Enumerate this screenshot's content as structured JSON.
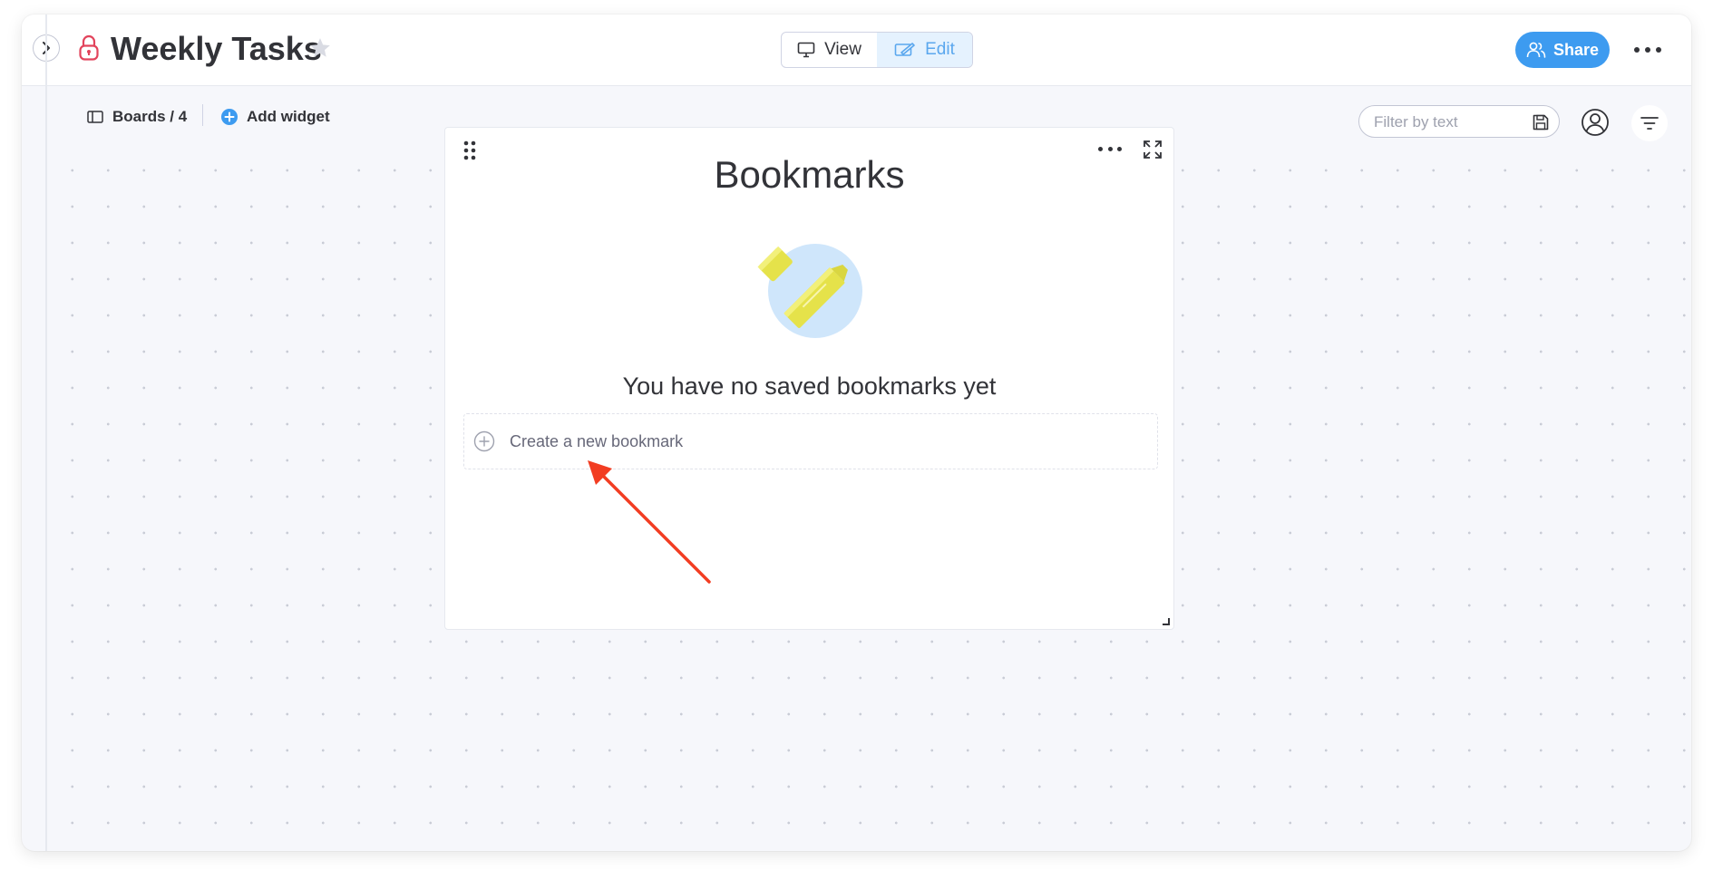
{
  "header": {
    "title": "Weekly Tasks",
    "view_label": "View",
    "edit_label": "Edit",
    "share_label": "Share"
  },
  "toolbar": {
    "boards_label": "Boards / 4",
    "add_widget_label": "Add widget",
    "filter_placeholder": "Filter by text"
  },
  "widget": {
    "title": "Bookmarks",
    "empty_message": "You have no saved bookmarks yet",
    "create_label": "Create a new bookmark"
  },
  "icons": {
    "collapse": "chevron-right-icon",
    "lock": "lock-icon",
    "star": "star-icon",
    "view": "monitor-icon",
    "edit": "edit-icon",
    "share": "people-icon",
    "more": "ellipsis-icon",
    "boards": "sidebar-icon",
    "add_widget": "plus-circle-icon",
    "save": "floppy-icon",
    "person": "person-icon",
    "filter": "filter-icon",
    "drag": "drag-handle-icon",
    "expand": "expand-icon"
  },
  "colors": {
    "accent": "#3d9bf0",
    "edit_active_bg": "#e5f2fe",
    "lock_red": "#e2445c",
    "annotation_arrow": "#f23d22",
    "canvas_bg": "#f6f7fb",
    "highlighter_yellow": "#e5e24a"
  }
}
